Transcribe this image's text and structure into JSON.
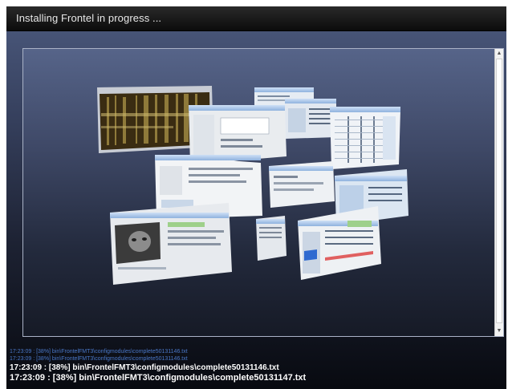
{
  "window": {
    "title": "Installing Frontel in progress ..."
  },
  "flip3d": {
    "scroll_up_arrow": "▲",
    "scroll_down_arrow": "▼"
  },
  "log": {
    "lines": [
      "17:23:09 : [38%] bin\\FrontelFMT3\\configmodules\\complete50131146.txt",
      "17:23:09 : [38%] bin\\FrontelFMT3\\configmodules\\complete50131146.txt",
      "17:23:09 : [38%] bin\\FrontelFMT3\\configmodules\\complete50131146.txt",
      "17:23:09 : [38%] bin\\FrontelFMT3\\configmodules\\complete50131147.txt"
    ]
  }
}
